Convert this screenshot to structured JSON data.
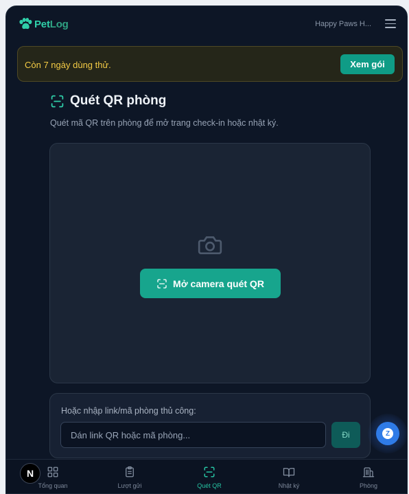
{
  "header": {
    "logo_pet": "Pet",
    "logo_log": "Log",
    "clinic_name": "Happy Paws H...",
    "menu_icon": "hamburger-icon"
  },
  "trial_banner": {
    "message": "Còn 7 ngày dùng thử.",
    "button_label": "Xem gói"
  },
  "page": {
    "title": "Quét QR phòng",
    "title_icon": "qr-scan-icon",
    "subtitle": "Quét mã QR trên phòng để mở trang check-in hoặc nhật ký."
  },
  "scanner": {
    "camera_icon": "camera-icon",
    "open_camera_label": "Mở camera quét QR"
  },
  "manual_entry": {
    "label": "Hoặc nhập link/mã phòng thủ công:",
    "input_placeholder": "Dán link QR hoặc mã phòng...",
    "input_value": "",
    "submit_label": "Đi"
  },
  "bottom_nav": {
    "items": [
      {
        "label": "Tổng quan",
        "icon": "grid-icon",
        "active": false
      },
      {
        "label": "Lượt gửi",
        "icon": "clipboard-icon",
        "active": false
      },
      {
        "label": "Quét QR",
        "icon": "qr-scan-icon",
        "active": true
      },
      {
        "label": "Nhật ký",
        "icon": "book-icon",
        "active": false
      },
      {
        "label": "Phòng",
        "icon": "building-icon",
        "active": false
      }
    ]
  },
  "dev_badge": {
    "letter": "N"
  },
  "fab": {
    "letter": "Z"
  },
  "colors": {
    "background": "#0d1626",
    "accent": "#17a58d",
    "trial_text": "#f5cc45",
    "fab": "#2f7be7"
  }
}
